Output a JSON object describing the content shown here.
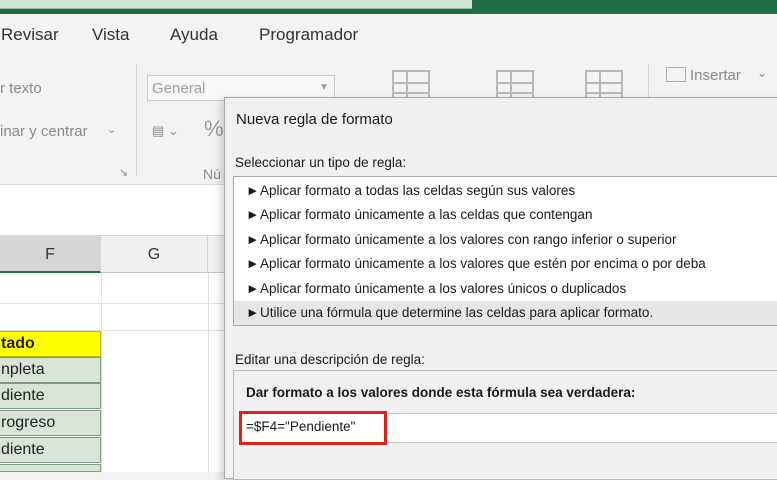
{
  "menu": {
    "tabs": [
      "Revisar",
      "Vista",
      "Ayuda",
      "Programador"
    ]
  },
  "ribbon": {
    "wrap_text": "r texto",
    "merge_center": "inar y centrar",
    "number_format": "General",
    "percent_symbol": "%",
    "number_group_partial": "Nú",
    "insert_label": "Insertar"
  },
  "grid": {
    "columns": [
      "F",
      "G"
    ],
    "cells_f": [
      "tado",
      "npleta",
      "diente",
      "rogreso",
      "diente"
    ]
  },
  "dialog": {
    "title": "Nueva regla de formato",
    "select_label": "Seleccionar un tipo de regla:",
    "rule_types": [
      "Aplicar formato a todas las celdas según sus valores",
      "Aplicar formato únicamente a las celdas que contengan",
      "Aplicar formato únicamente a los valores con rango inferior o superior",
      "Aplicar formato únicamente a los valores que estén por encima o por deba",
      "Aplicar formato únicamente a los valores únicos o duplicados",
      "Utilice una fórmula que determine las celdas para aplicar formato."
    ],
    "edit_label": "Editar una descripción de regla:",
    "formula_heading": "Dar formato a los valores donde esta fórmula sea verdadera:",
    "formula_value": "=$F4=\"Pendiente\""
  },
  "colors": {
    "excel_green": "#1e6e43",
    "header_yellow": "#ffff00",
    "highlight_red": "#e0201c"
  }
}
